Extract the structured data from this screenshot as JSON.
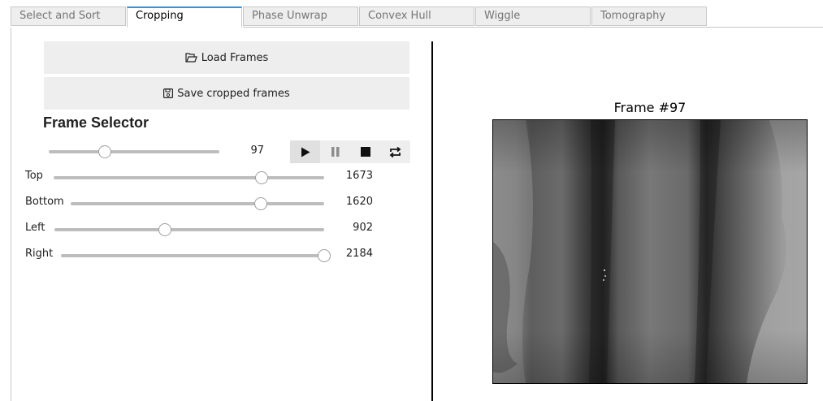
{
  "tabs": [
    {
      "label": "Select and Sort",
      "active": false
    },
    {
      "label": "Cropping",
      "active": true
    },
    {
      "label": "Phase Unwrap",
      "active": false
    },
    {
      "label": "Convex Hull",
      "active": false
    },
    {
      "label": "Wiggle",
      "active": false
    },
    {
      "label": "Tomography",
      "active": false
    }
  ],
  "buttons": {
    "load_label": "Load Frames",
    "load_icon": "folder-open-icon",
    "save_label": "Save cropped frames",
    "save_icon": "floppy-disk-icon"
  },
  "frame_selector": {
    "title": "Frame Selector",
    "value": "97",
    "slider_fraction": 0.33,
    "player_icons": [
      "play-icon",
      "pause-icon",
      "stop-icon",
      "repeat-icon"
    ]
  },
  "crop": {
    "top": {
      "label": "Top",
      "value": "1673",
      "fraction": 0.77
    },
    "bottom": {
      "label": "Bottom",
      "value": "1620",
      "fraction": 0.75
    },
    "left": {
      "label": "Left",
      "value": "902",
      "fraction": 0.41
    },
    "right": {
      "label": "Right",
      "value": "2184",
      "fraction": 1.0
    }
  },
  "figure": {
    "title": "Frame #97"
  }
}
